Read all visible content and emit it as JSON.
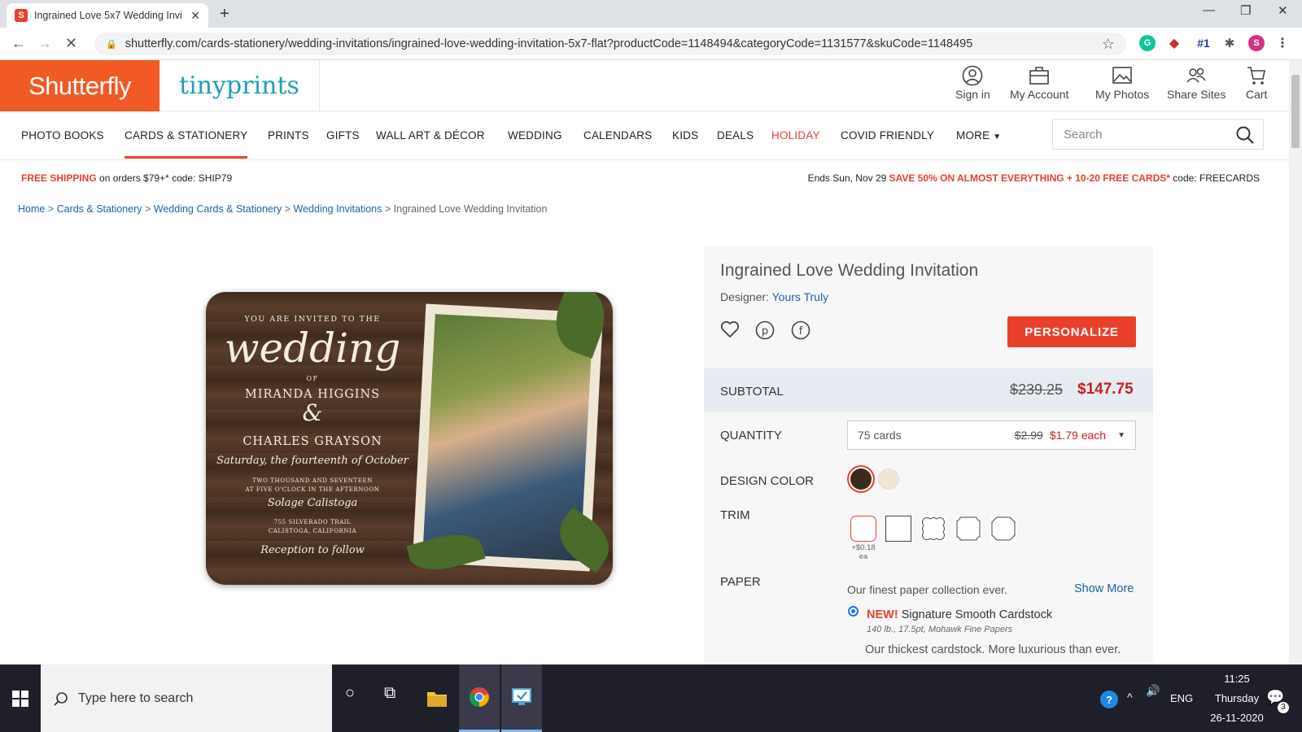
{
  "browser": {
    "tab_title": "Ingrained Love 5x7 Wedding Invi",
    "favicon_letter": "S",
    "url": "shutterfly.com/cards-stationery/wedding-invitations/ingrained-love-wedding-invitation-5x7-flat?productCode=1148494&categoryCode=1131577&skuCode=1148495",
    "ext_badge": "#1",
    "profile_letter": "S"
  },
  "header": {
    "logo_shutterfly": "Shutterfly",
    "logo_tinyprints": "tinyprints",
    "items": [
      {
        "label": "Sign in",
        "icon": "user-icon"
      },
      {
        "label": "My Account",
        "icon": "briefcase-icon"
      },
      {
        "label": "My Photos",
        "icon": "image-icon"
      },
      {
        "label": "Share Sites",
        "icon": "people-icon"
      },
      {
        "label": "Cart",
        "icon": "cart-icon"
      }
    ]
  },
  "nav": {
    "items": [
      "PHOTO BOOKS",
      "CARDS & STATIONERY",
      "PRINTS",
      "GIFTS",
      "WALL ART & DÉCOR",
      "WEDDING",
      "CALENDARS",
      "KIDS",
      "DEALS",
      "HOLIDAY",
      "COVID FRIENDLY",
      "MORE"
    ],
    "search_placeholder": "Search"
  },
  "promo": {
    "left_bold": "FREE SHIPPING",
    "left_text": " on orders $79+* code: SHIP79",
    "right_prefix": "Ends Sun, Nov 29 ",
    "right_bold": "SAVE 50% ON ALMOST EVERYTHING + 10-20 FREE CARDS*",
    "right_suffix": " code: FREECARDS"
  },
  "breadcrumb": {
    "links": [
      "Home",
      "Cards & Stationery",
      "Wedding Cards & Stationery",
      "Wedding Invitations"
    ],
    "current": "Ingrained Love Wedding Invitation",
    "separator": " > "
  },
  "card": {
    "invited": "YOU ARE INVITED TO THE",
    "wedding": "wedding",
    "of": "OF",
    "name1": "MIRANDA HIGGINS",
    "amp": "&",
    "name2": "CHARLES GRAYSON",
    "date_script": "Saturday, the fourteenth of October",
    "year_line": "TWO THOUSAND AND SEVENTEEN",
    "time_line": "AT FIVE O'CLOCK IN THE AFTERNOON",
    "venue_script": "Solage Calistoga",
    "address1": "755 SILVERADO TRAIL",
    "address2": "CALISTOGA, CALIFORNIA",
    "reception": "Reception to follow"
  },
  "product": {
    "title": "Ingrained Love Wedding Invitation",
    "designer_label": "Designer: ",
    "designer_name": "Yours Truly",
    "personalize_label": "PERSONALIZE",
    "subtotal_label": "SUBTOTAL",
    "subtotal_old": "$239.25",
    "subtotal_new": "$147.75",
    "quantity_label": "QUANTITY",
    "quantity_value": "75 cards",
    "price_old": "$2.99",
    "price_new": "$1.79 each",
    "design_color_label": "DESIGN COLOR",
    "colors": [
      "#3d2b1a",
      "#f2e6d2"
    ],
    "trim_label": "TRIM",
    "trim_price": "+$0.18 ea",
    "paper_label": "PAPER",
    "paper_desc": "Our finest paper collection ever.",
    "show_more": "Show More",
    "paper_new_tag": "NEW!",
    "paper_name": " Signature Smooth Cardstock",
    "paper_spec": "140 lb., 17.5pt, Mohawk Fine Papers",
    "paper_long": "Our thickest cardstock. More luxurious than ever."
  },
  "taskbar": {
    "search_placeholder": "Type here to search",
    "lang": "ENG",
    "time": "11:25",
    "day": "Thursday",
    "date": "26-11-2020",
    "notif_count": "3"
  },
  "colors": {
    "accent": "#e8412b",
    "shutterfly_orange": "#f15a24",
    "tinyprints_teal": "#1ba1b8",
    "link_blue": "#2162a6",
    "price_red": "#c8201c"
  }
}
